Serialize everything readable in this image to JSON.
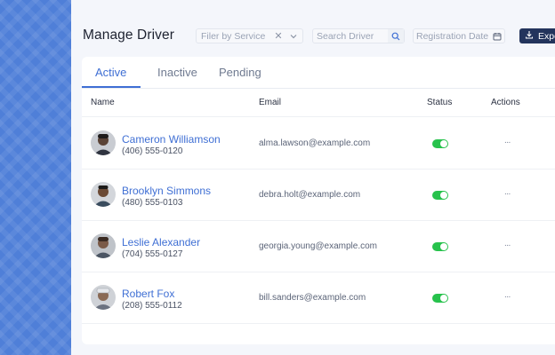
{
  "header": {
    "title": "Manage Driver",
    "filter_placeholder": "Filer by Service",
    "search_placeholder": "Search Driver",
    "date_placeholder": "Registration Date",
    "export_label": "Expo"
  },
  "tabs": [
    {
      "label": "Active",
      "active": true
    },
    {
      "label": "Inactive",
      "active": false
    },
    {
      "label": "Pending",
      "active": false
    }
  ],
  "columns": {
    "name": "Name",
    "email": "Email",
    "status": "Status",
    "actions": "Actions"
  },
  "rows": [
    {
      "name": "Cameron Williamson",
      "phone": "(406) 555-0120",
      "email": "alma.lawson@example.com",
      "status": "on",
      "actions": "..."
    },
    {
      "name": "Brooklyn Simmons",
      "phone": "(480) 555-0103",
      "email": "debra.holt@example.com",
      "status": "on",
      "actions": "..."
    },
    {
      "name": "Leslie Alexander",
      "phone": "(704) 555-0127",
      "email": "georgia.young@example.com",
      "status": "on",
      "actions": "..."
    },
    {
      "name": "Robert Fox",
      "phone": "(208) 555-0112",
      "email": "bill.sanders@example.com",
      "status": "on",
      "actions": "..."
    }
  ],
  "colors": {
    "accent": "#3f6fd4",
    "toggle_on": "#27c24c",
    "export_bg": "#23345c",
    "sidebar": "#4f7fd8"
  },
  "icons": {
    "filter_clear": "close-icon",
    "filter_open": "chevron-down-icon",
    "search": "search-icon",
    "date": "calendar-icon",
    "export": "download-icon",
    "avatar": "avatar-photo"
  }
}
